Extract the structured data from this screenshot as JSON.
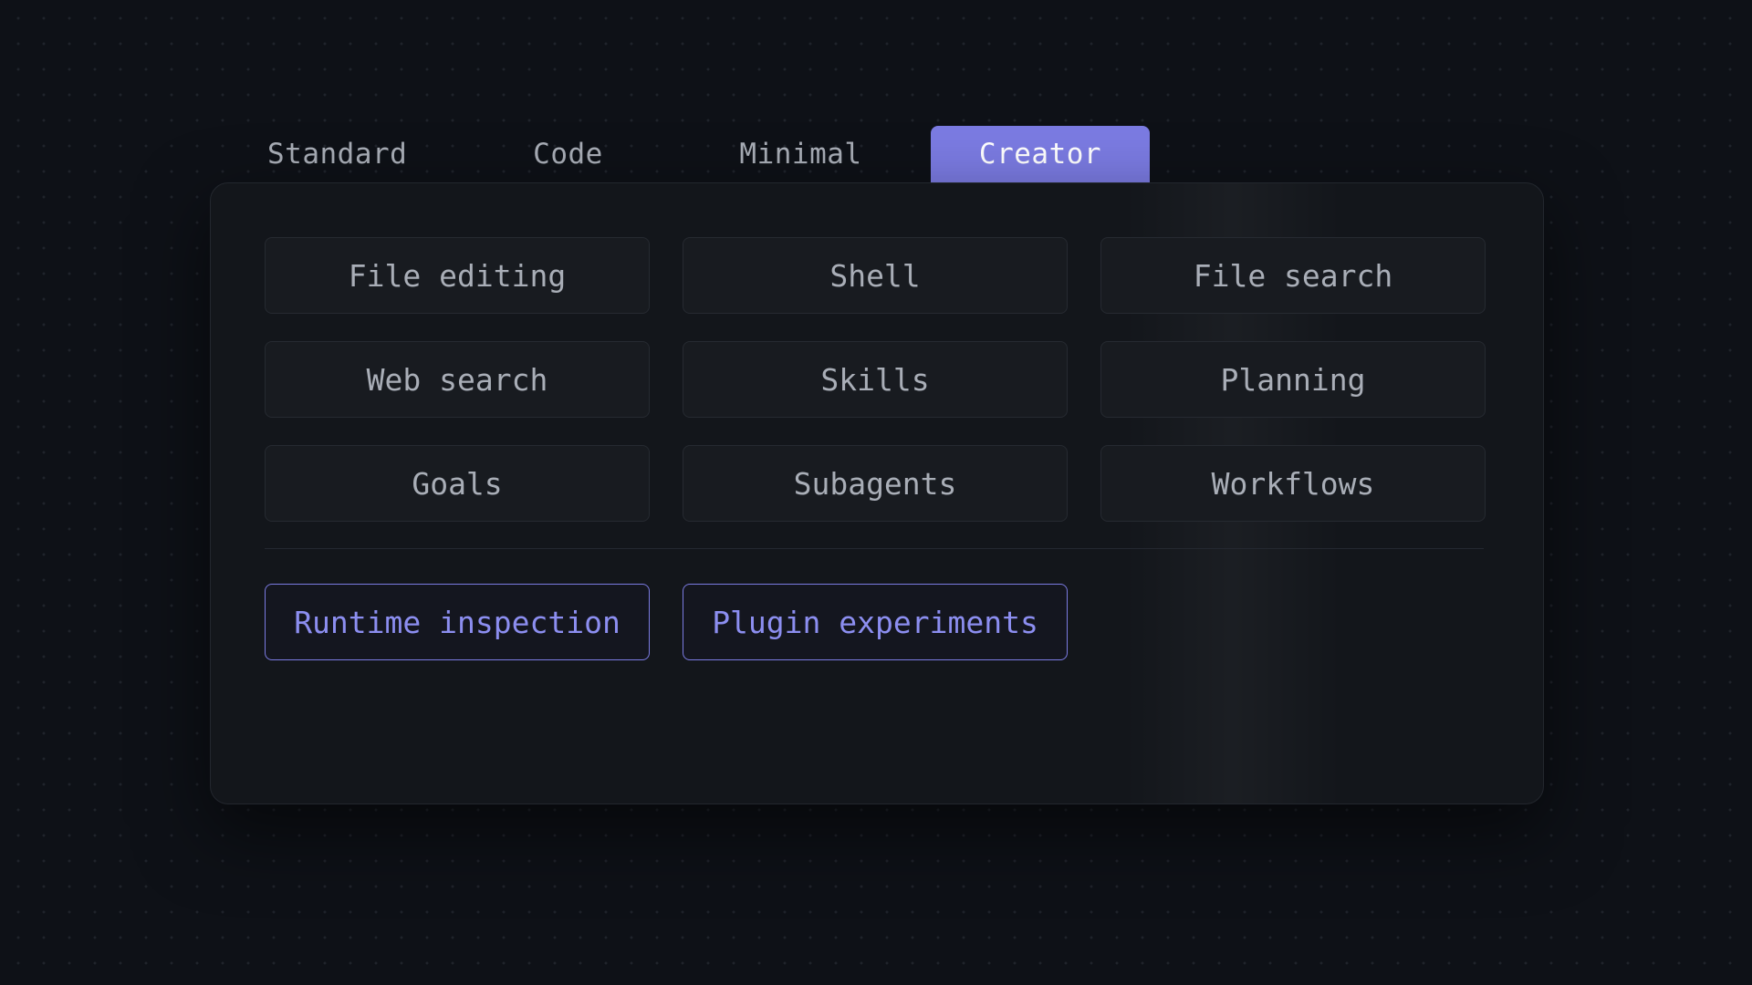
{
  "tabs": [
    {
      "label": "Standard",
      "active": false
    },
    {
      "label": "Code",
      "active": false
    },
    {
      "label": "Minimal",
      "active": false
    },
    {
      "label": "Creator",
      "active": true
    }
  ],
  "capabilities": [
    "File editing",
    "Shell",
    "File search",
    "Web search",
    "Skills",
    "Planning",
    "Goals",
    "Subagents",
    "Workflows"
  ],
  "extras": [
    "Runtime inspection",
    "Plugin experiments"
  ],
  "colors": {
    "background": "#0e1117",
    "panel": "#13161b",
    "accent": "#7b7be2",
    "accent_text": "#8c8ef0",
    "text": "#a9aeb7"
  }
}
